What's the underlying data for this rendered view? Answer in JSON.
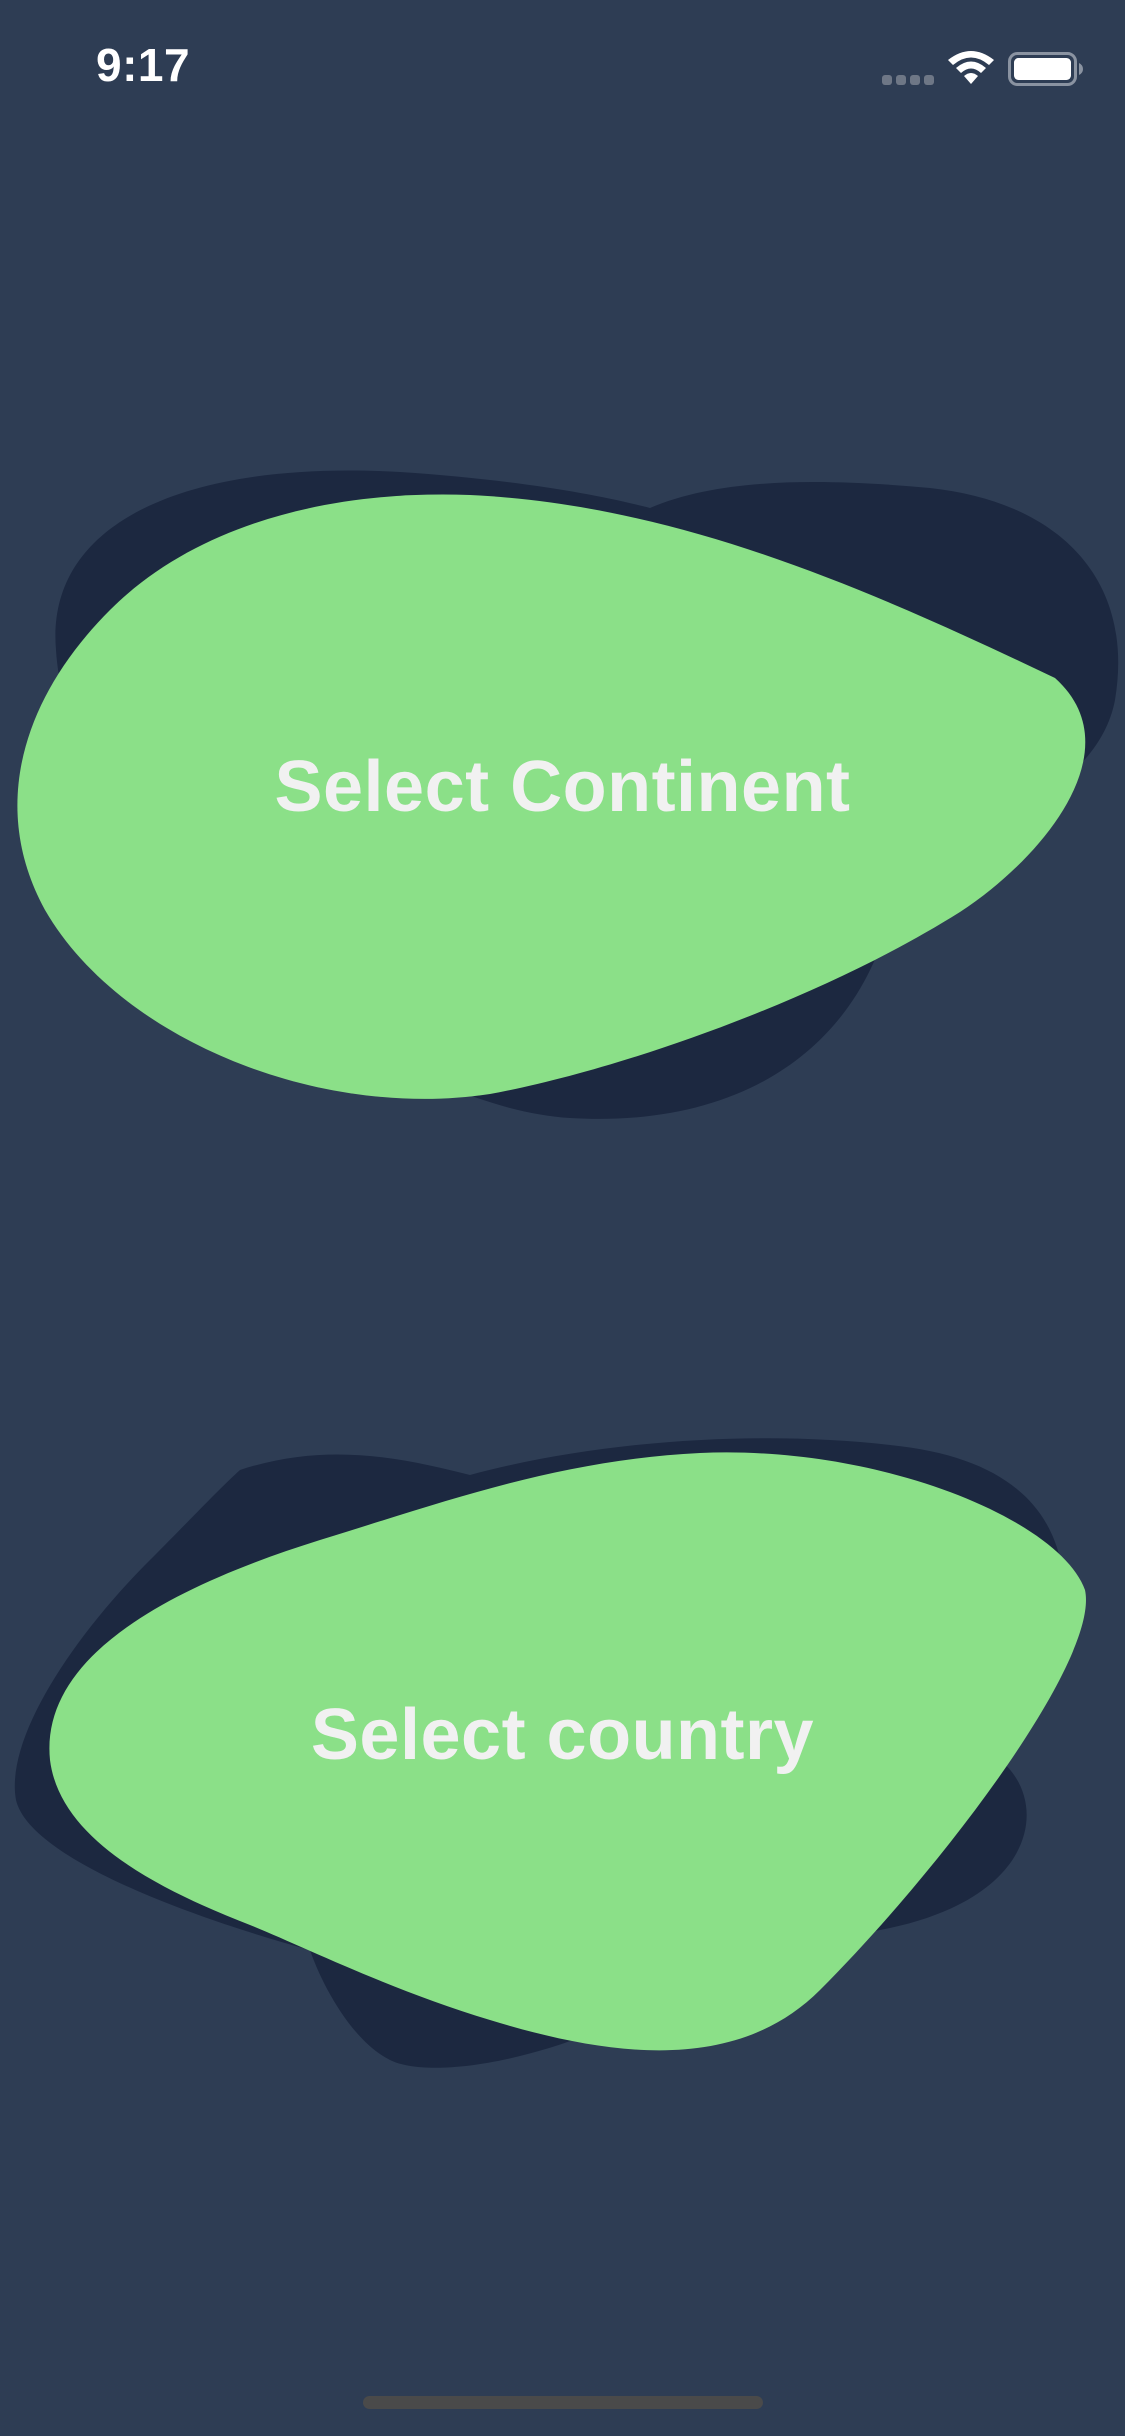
{
  "status_bar": {
    "time": "9:17",
    "icons": [
      "signal-dots-icon",
      "wifi-icon",
      "battery-icon"
    ]
  },
  "buttons": {
    "continent": {
      "label": "Select Continent"
    },
    "country": {
      "label": "Select country"
    }
  },
  "colors": {
    "background": "#2E3D54",
    "blob_fill": "#8BE088",
    "blob_shadow": "#1C2840",
    "label_text": "#F1F1F1",
    "status_text": "#FFFFFF",
    "home_indicator": "#4A4A4A"
  }
}
